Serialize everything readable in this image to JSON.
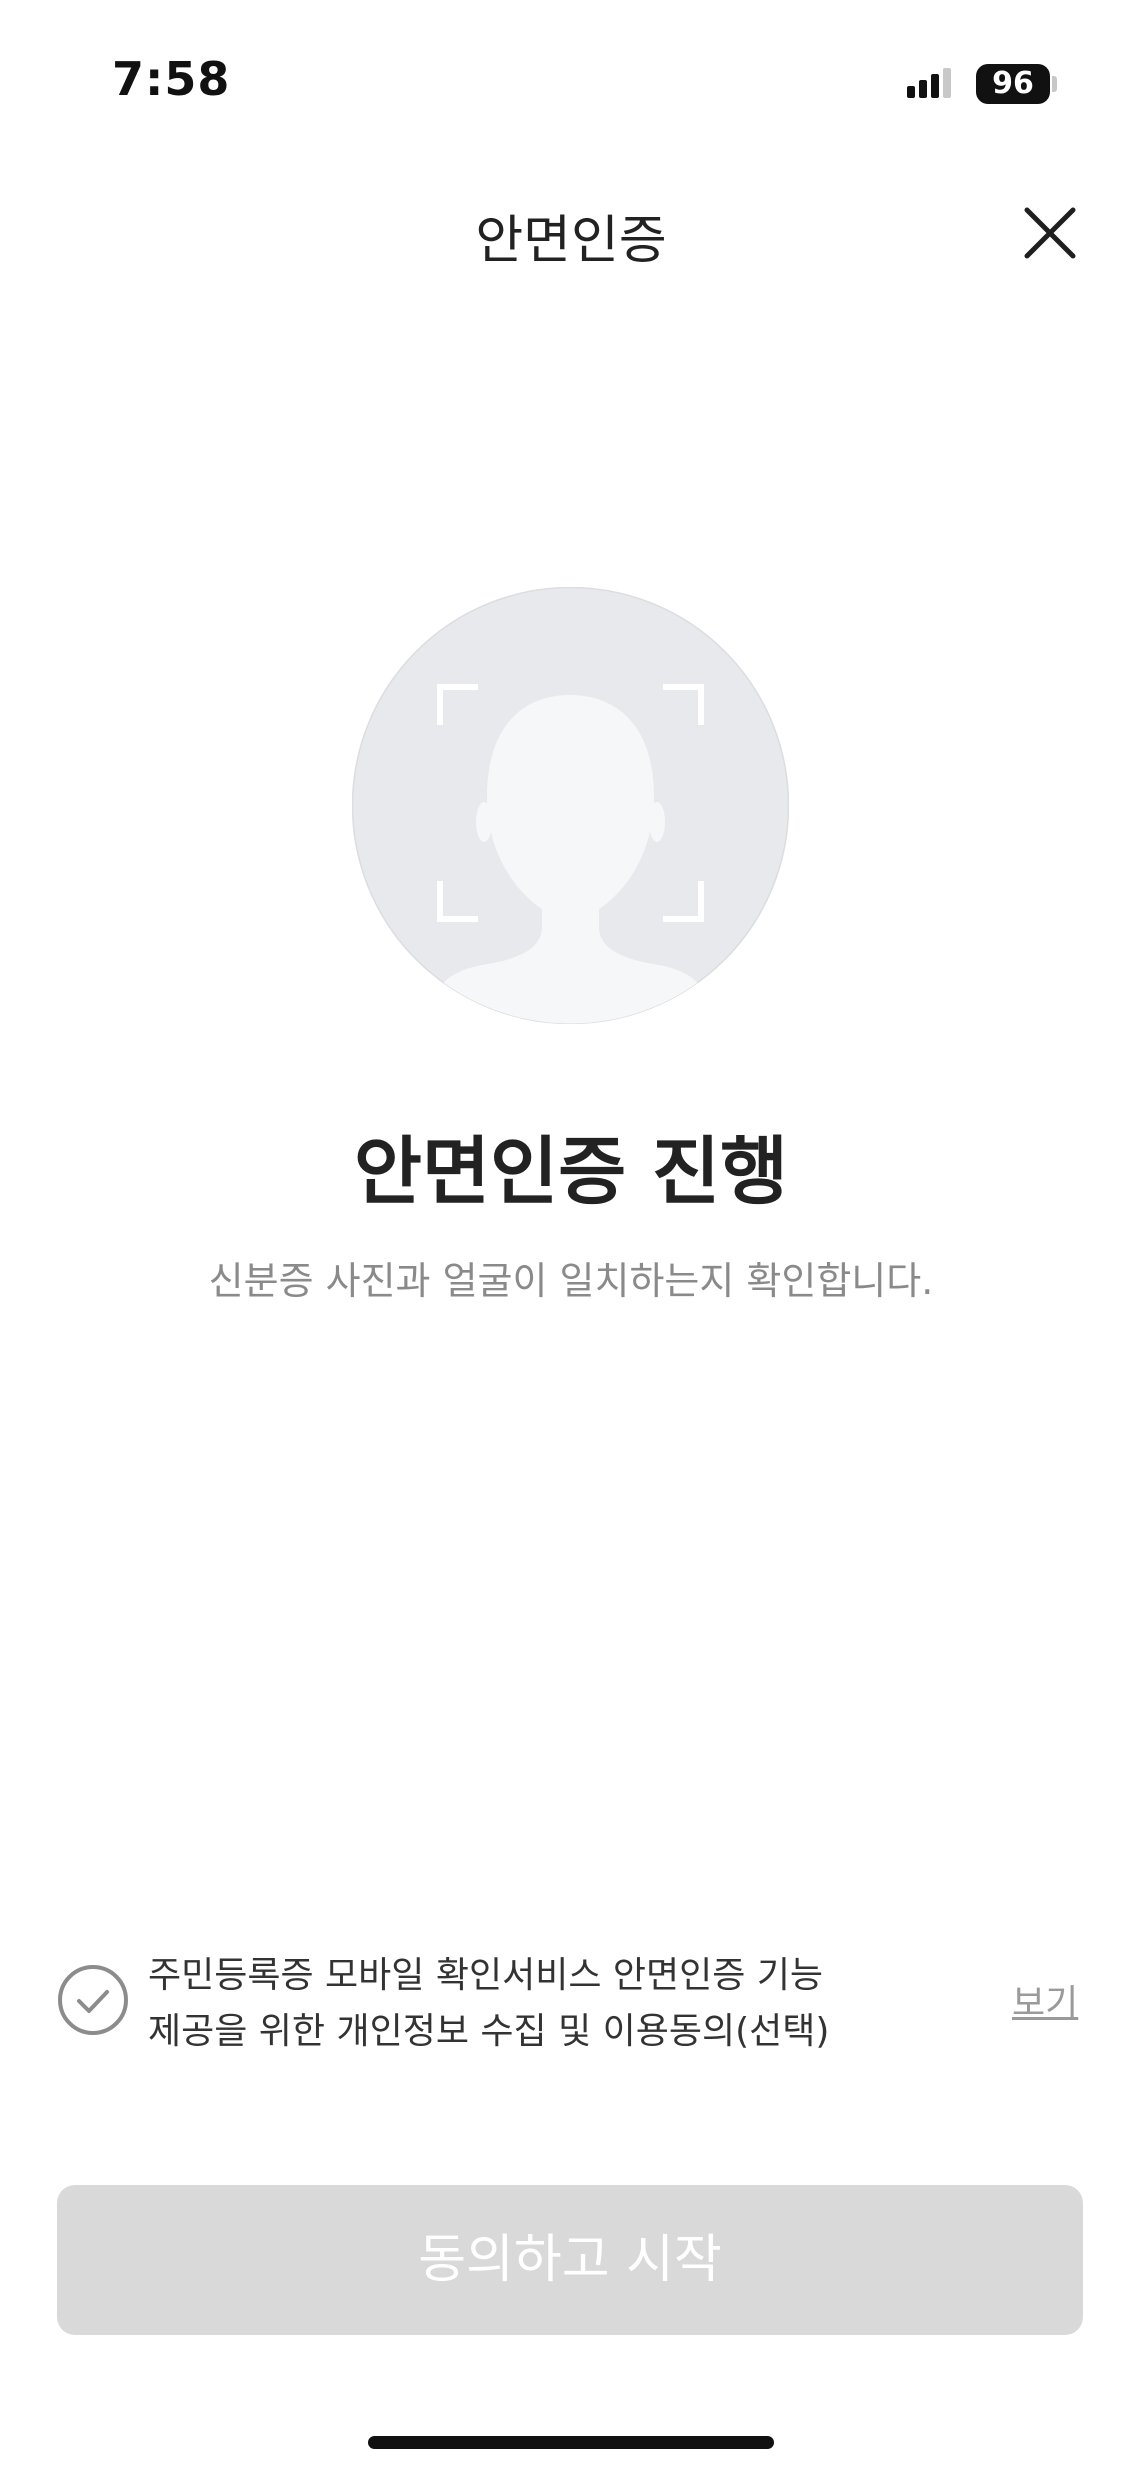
{
  "status_bar": {
    "time": "7:58",
    "battery": "96"
  },
  "header": {
    "title": "안면인증",
    "close_icon": "close-icon"
  },
  "hero": {
    "illustration_icon": "face-scan-icon",
    "title": "안면인증 진행",
    "subtitle": "신분증 사진과 얼굴이 일치하는지 확인합니다."
  },
  "consent": {
    "check_icon": "check-circle-icon",
    "line1": "주민등록증 모바일 확인서비스 안면인증 기능",
    "line2": "제공을 위한 개인정보 수집 및 이용동의(선택)",
    "view_label": "보기"
  },
  "footer": {
    "start_label": "동의하고 시작",
    "start_enabled": false
  },
  "colors": {
    "avatar_bg": "#e8e9ec",
    "silhouette": "#f6f7f9",
    "button_disabled": "#d9d9d9",
    "subtitle": "#8a8a8a"
  }
}
